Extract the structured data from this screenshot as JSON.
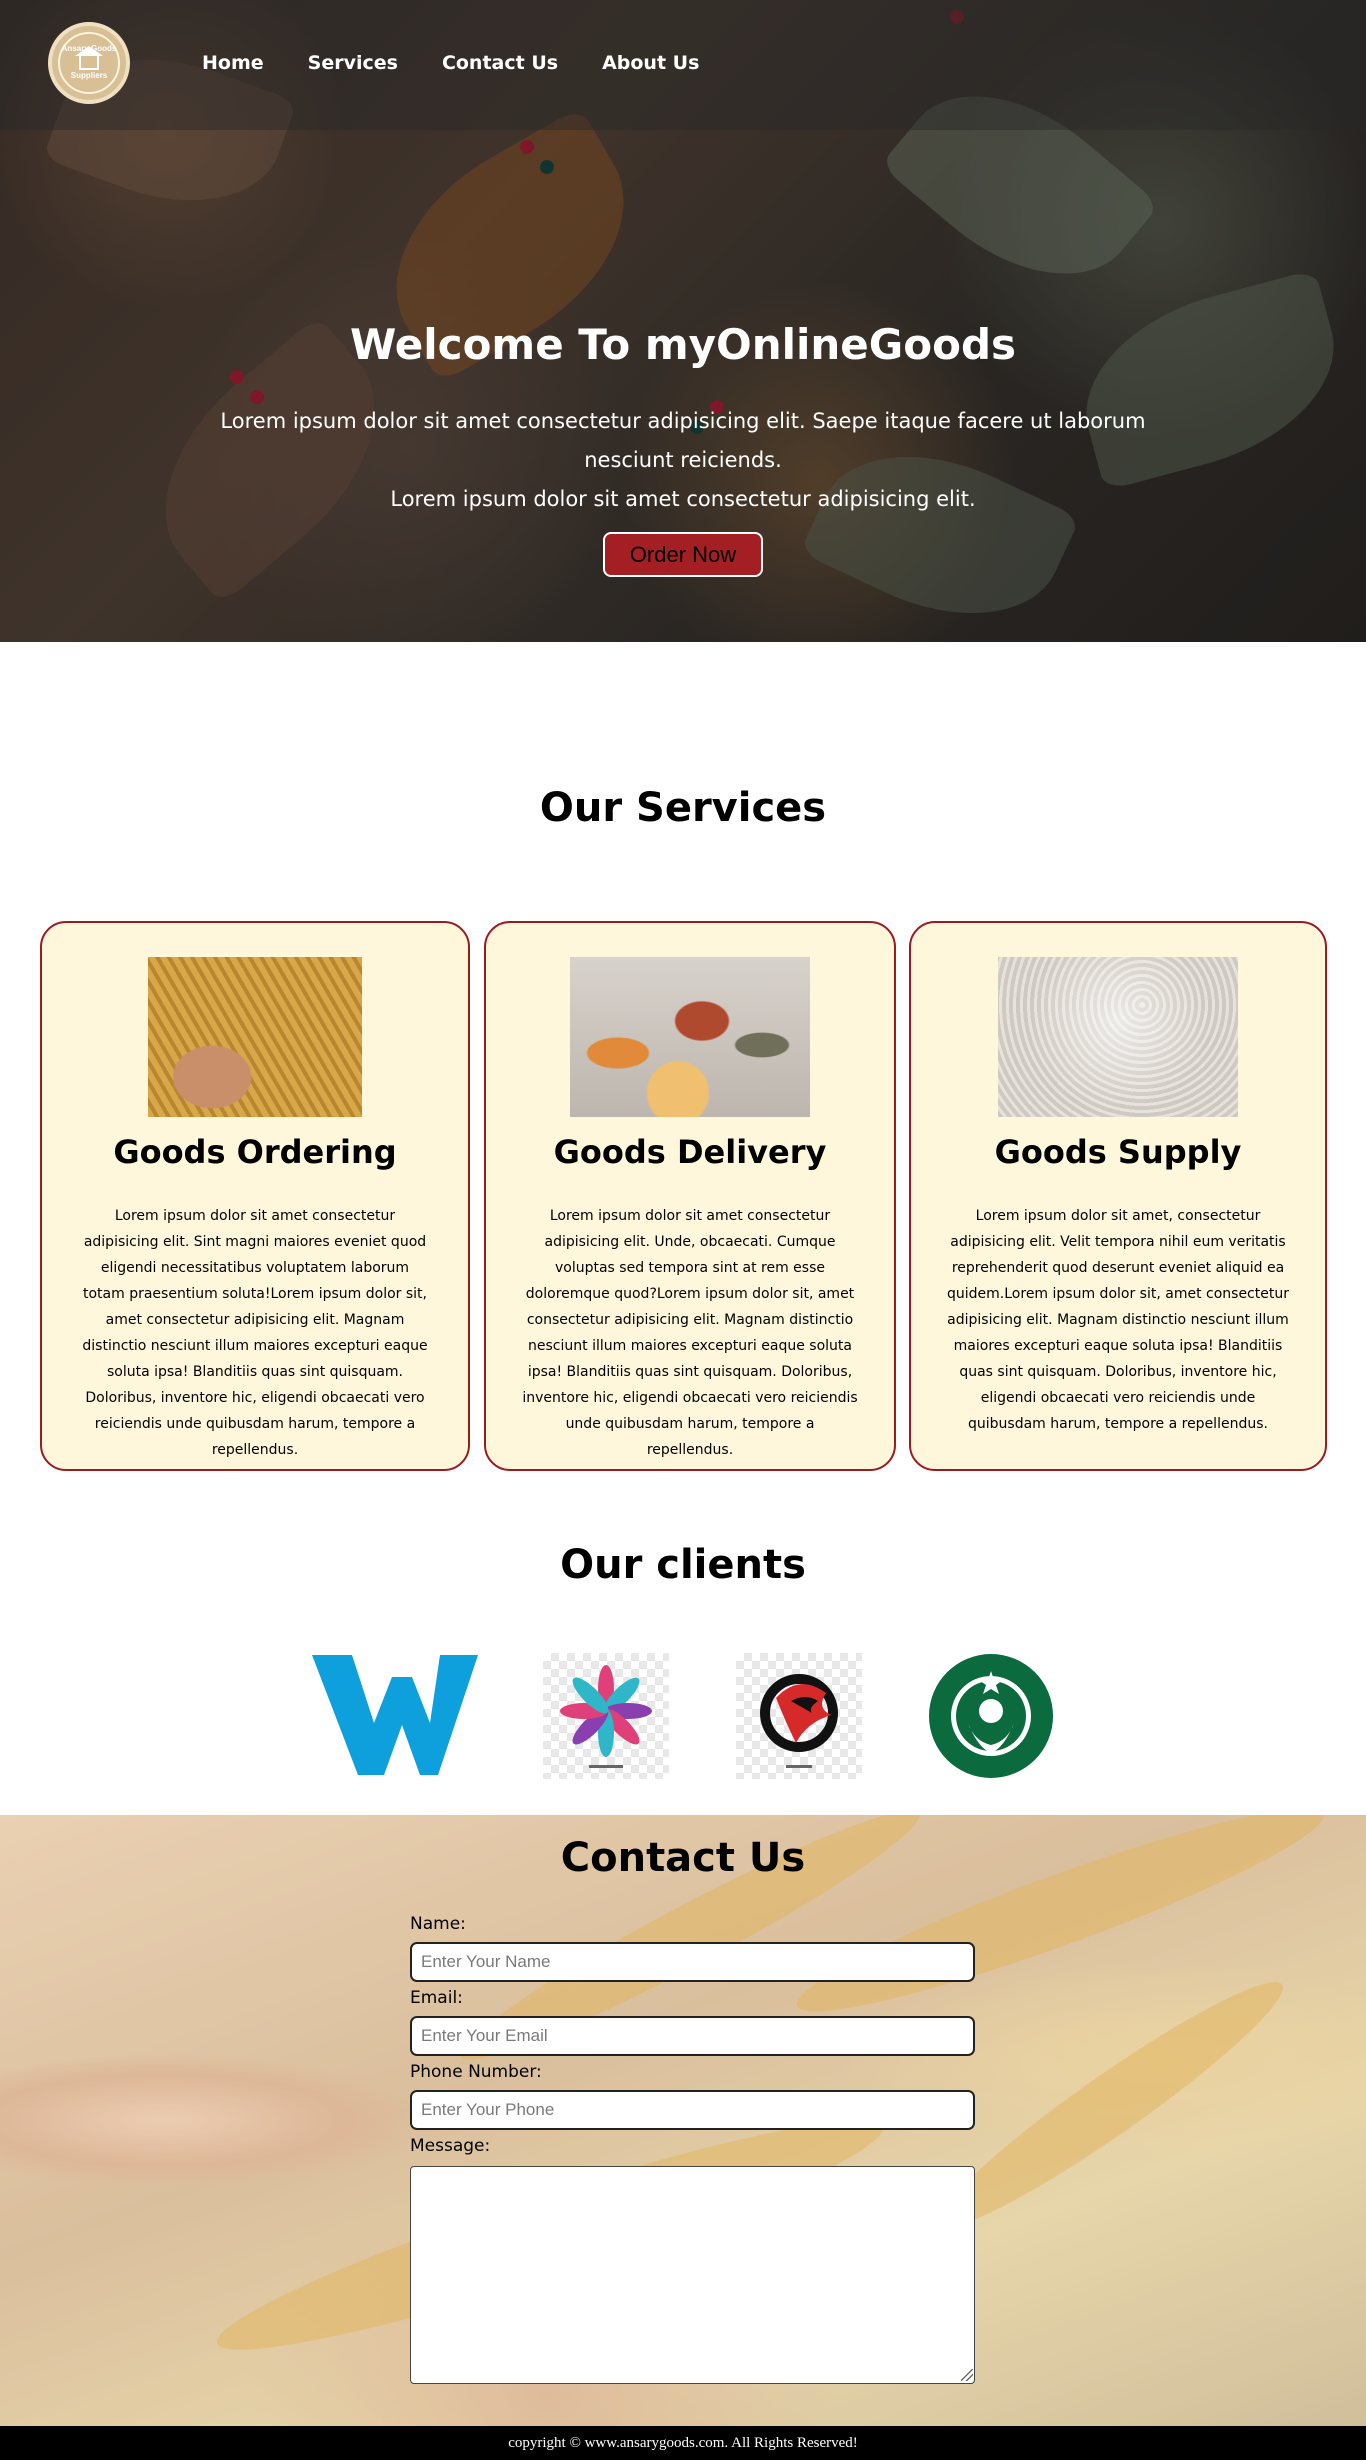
{
  "logo": {
    "text_top": "Ansary Goods",
    "text_bottom": "Suppliers"
  },
  "nav": {
    "items": [
      {
        "label": "Home"
      },
      {
        "label": "Services"
      },
      {
        "label": "Contact Us"
      },
      {
        "label": "About Us"
      }
    ]
  },
  "hero": {
    "title": "Welcome To myOnlineGoods",
    "subtitle_line1": "Lorem ipsum dolor sit amet consectetur adipisicing elit. Saepe itaque facere ut laborum nesciunt reiciends.",
    "subtitle_line2": "Lorem ipsum dolor sit amet consectetur adipisicing elit.",
    "button_label": "Order Now"
  },
  "services": {
    "title": "Our Services",
    "cards": [
      {
        "title": "Goods Ordering",
        "text": "Lorem ipsum dolor sit amet consectetur adipisicing elit. Sint magni maiores eveniet quod eligendi necessitatibus voluptatem laborum totam praesentium soluta!Lorem ipsum dolor sit, amet consectetur adipisicing elit. Magnam distinctio nesciunt illum maiores excepturi eaque soluta ipsa! Blanditiis quas sint quisquam. Doloribus, inventore hic, eligendi obcaecati vero reiciendis unde quibusdam harum, tempore a repellendus."
      },
      {
        "title": "Goods Delivery",
        "text": "Lorem ipsum dolor sit amet consectetur adipisicing elit. Unde, obcaecati. Cumque voluptas sed tempora sint at rem esse doloremque quod?Lorem ipsum dolor sit, amet consectetur adipisicing elit. Magnam distinctio nesciunt illum maiores excepturi eaque soluta ipsa! Blanditiis quas sint quisquam. Doloribus, inventore hic, eligendi obcaecati vero reiciendis unde quibusdam harum, tempore a repellendus."
      },
      {
        "title": "Goods Supply",
        "text": "Lorem ipsum dolor sit amet, consectetur adipisicing elit. Velit tempora nihil eum veritatis reprehenderit quod deserunt eveniet aliquid ea quidem.Lorem ipsum dolor sit, amet consectetur adipisicing elit. Magnam distinctio nesciunt illum maiores excepturi eaque soluta ipsa! Blanditiis quas sint quisquam. Doloribus, inventore hic, eligendi obcaecati vero reiciendis unde quibusdam harum, tempore a repellendus."
      }
    ]
  },
  "clients": {
    "title": "Our clients",
    "logos": [
      "w-logo",
      "flower-logo",
      "eagle-logo",
      "starbucks-logo"
    ]
  },
  "contact": {
    "title": "Contact Us",
    "name_label": "Name:",
    "name_placeholder": "Enter Your Name",
    "email_label": "Email:",
    "email_placeholder": "Enter Your Email",
    "phone_label": "Phone Number:",
    "phone_placeholder": "Enter Your Phone",
    "message_label": "Message:"
  },
  "footer": {
    "text": "copyright © www.ansarygoods.com. All Rights Reserved!"
  },
  "colors": {
    "accent": "#a41f24",
    "card_bg": "#fff7dc",
    "card_border": "#9a1b20"
  }
}
